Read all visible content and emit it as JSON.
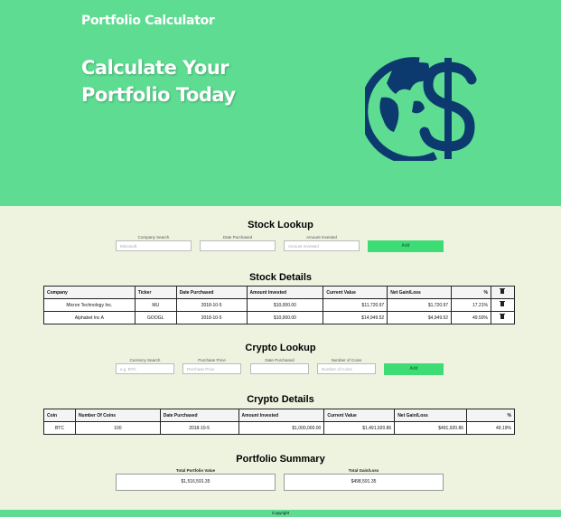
{
  "brand": "Portfolio Calculator",
  "hero": {
    "line1": "Calculate Your",
    "line2": "Portfolio Today"
  },
  "colors": {
    "hero_bg": "#5ddc92",
    "logo": "#0d3a6e",
    "body_bg": "#eef3e0",
    "button": "#3ddc75"
  },
  "stock_lookup": {
    "title": "Stock Lookup",
    "company_label": "Company Search",
    "company_placeholder": "Microsoft",
    "date_label": "Date Purchased",
    "date_value": "",
    "amount_label": "Amount Invested",
    "amount_placeholder": "Amount Invested",
    "add_label": "Add"
  },
  "stock_details": {
    "title": "Stock Details",
    "headers": [
      "Company",
      "Ticker",
      "Date Purchased",
      "Amount Invested",
      "Current Value",
      "Net Gain/Loss",
      "%"
    ],
    "rows": [
      {
        "company": "Micron Technology Inc.",
        "ticker": "MU",
        "date": "2018-10-5",
        "invested": "$10,000.00",
        "current": "$11,720.97",
        "net": "$1,720.97",
        "pct": "17.21%"
      },
      {
        "company": "Alphabet Inc A",
        "ticker": "GOOGL",
        "date": "2018-10-5",
        "invested": "$10,000.00",
        "current": "$14,949.52",
        "net": "$4,949.52",
        "pct": "49.50%"
      }
    ]
  },
  "crypto_lookup": {
    "title": "Crypto Lookup",
    "currency_label": "Currency Search",
    "currency_placeholder": "e.g. BTC",
    "price_label": "Purchase Price",
    "price_placeholder": "Purchase Price",
    "date_label": "Date Purchased",
    "date_value": "",
    "coins_label": "Number of Coins",
    "coins_placeholder": "Number of Coins",
    "add_label": "Add"
  },
  "crypto_details": {
    "title": "Crypto Details",
    "headers": [
      "Coin",
      "Number Of Coins",
      "Date Purchased",
      "Amount Invested",
      "Current Value",
      "Net Gain/Loss",
      "%"
    ],
    "rows": [
      {
        "coin": "BTC",
        "coins": "100",
        "date": "2018-10-5",
        "invested": "$1,000,000.00",
        "current": "$1,491,920.86",
        "net": "$491,920.86",
        "pct": "49.19%"
      }
    ]
  },
  "summary": {
    "title": "Portfolio Summary",
    "total_value_label": "Total Portfolio Value",
    "total_value": "$1,516,591.35",
    "total_gain_label": "Total Gain/Loss",
    "total_gain": "$498,591.35"
  },
  "footer": "Copyright"
}
